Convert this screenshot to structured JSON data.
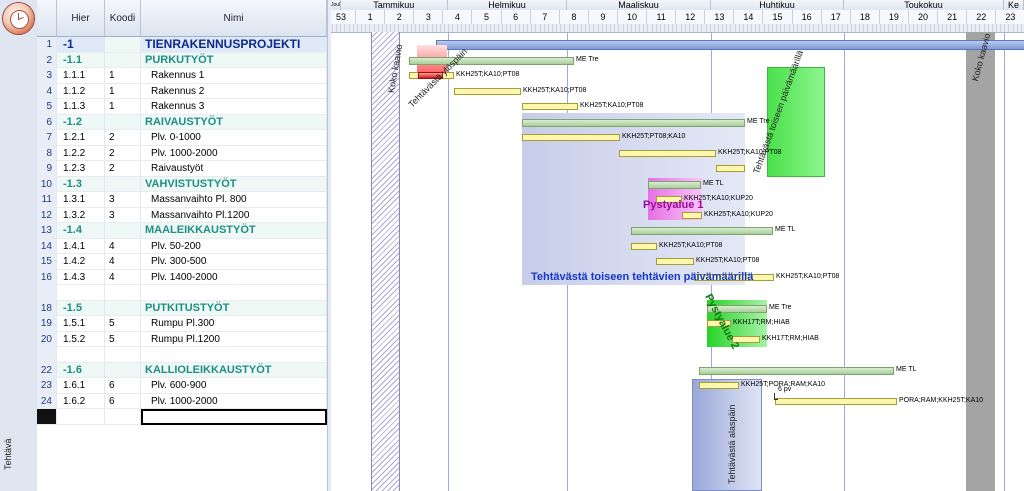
{
  "side": {
    "tab_label": "Tehtävä"
  },
  "grid": {
    "headers": {
      "hier": "Hier",
      "koodi": "Koodi",
      "nimi": "Nimi"
    },
    "rows": [
      {
        "n": "1",
        "hier": "-1",
        "koodi": "",
        "nimi": "TIENRAKENNUSPROJEKTI",
        "type": "level0"
      },
      {
        "n": "2",
        "hier": "-1.1",
        "koodi": "",
        "nimi": "PURKUTYÖT",
        "type": "summary"
      },
      {
        "n": "3",
        "hier": "1.1.1",
        "koodi": "1",
        "nimi": "Rakennus 1",
        "type": "task"
      },
      {
        "n": "4",
        "hier": "1.1.2",
        "koodi": "1",
        "nimi": "Rakennus 2",
        "type": "task"
      },
      {
        "n": "5",
        "hier": "1.1.3",
        "koodi": "1",
        "nimi": "Rakennus 3",
        "type": "task"
      },
      {
        "n": "6",
        "hier": "-1.2",
        "koodi": "",
        "nimi": "RAIVAUSTYÖT",
        "type": "summary"
      },
      {
        "n": "7",
        "hier": "1.2.1",
        "koodi": "2",
        "nimi": "Plv. 0-1000",
        "type": "task"
      },
      {
        "n": "8",
        "hier": "1.2.2",
        "koodi": "2",
        "nimi": "Plv. 1000-2000",
        "type": "task"
      },
      {
        "n": "9",
        "hier": "1.2.3",
        "koodi": "2",
        "nimi": "Raivaustyöt",
        "type": "task"
      },
      {
        "n": "10",
        "hier": "-1.3",
        "koodi": "",
        "nimi": "VAHVISTUSTYÖT",
        "type": "summary"
      },
      {
        "n": "11",
        "hier": "1.3.1",
        "koodi": "3",
        "nimi": "Massanvaihto Pl. 800",
        "type": "task"
      },
      {
        "n": "12",
        "hier": "1.3.2",
        "koodi": "3",
        "nimi": "Massanvaihto Pl.1200",
        "type": "task"
      },
      {
        "n": "13",
        "hier": "-1.4",
        "koodi": "",
        "nimi": "MAALEIKKAUSTYÖT",
        "type": "summary"
      },
      {
        "n": "14",
        "hier": "1.4.1",
        "koodi": "4",
        "nimi": "Plv. 50-200",
        "type": "task"
      },
      {
        "n": "15",
        "hier": "1.4.2",
        "koodi": "4",
        "nimi": "Plv. 300-500",
        "type": "task"
      },
      {
        "n": "16",
        "hier": "1.4.3",
        "koodi": "4",
        "nimi": "Plv. 1400-2000",
        "type": "task"
      },
      {
        "n": "",
        "hier": "",
        "koodi": "",
        "nimi": "",
        "type": "blank"
      },
      {
        "n": "18",
        "hier": "-1.5",
        "koodi": "",
        "nimi": "PUTKITUSTYÖT",
        "type": "summary"
      },
      {
        "n": "19",
        "hier": "1.5.1",
        "koodi": "5",
        "nimi": "Rumpu Pl.300",
        "type": "task"
      },
      {
        "n": "20",
        "hier": "1.5.2",
        "koodi": "5",
        "nimi": "Rumpu Pl.1200",
        "type": "task"
      },
      {
        "n": "",
        "hier": "",
        "koodi": "",
        "nimi": "",
        "type": "blank"
      },
      {
        "n": "22",
        "hier": "-1.6",
        "koodi": "",
        "nimi": "KALLIOLEIKKAUSTYÖT",
        "type": "summary"
      },
      {
        "n": "23",
        "hier": "1.6.1",
        "koodi": "6",
        "nimi": "Plv. 600-900",
        "type": "task"
      },
      {
        "n": "24",
        "hier": "1.6.2",
        "koodi": "6",
        "nimi": "Plv. 1000-2000",
        "type": "task"
      },
      {
        "n": "",
        "hier": "",
        "koodi": "",
        "nimi": "",
        "type": "sel"
      }
    ]
  },
  "timeline": {
    "months": [
      "Joul",
      "Tammikuu",
      "Helmikuu",
      "Maaliskuu",
      "Huhtikuu",
      "Toukokuu",
      "Ke"
    ],
    "weeks": [
      "53",
      "1",
      "2",
      "3",
      "4",
      "5",
      "6",
      "7",
      "8",
      "9",
      "10",
      "11",
      "12",
      "13",
      "14",
      "15",
      "16",
      "17",
      "18",
      "19",
      "20",
      "21",
      "22",
      "23"
    ]
  },
  "gantt": {
    "labels": {
      "r2": "ME Tre",
      "r3": "KKH25T;KA10;PT08",
      "r4": "KKH25T;KA10;PT08",
      "r5": "KKH25T;KA10;PT08",
      "r6": "ME Tre",
      "r7": "KKH25T;PT08;KA10",
      "r8": "KKH25T;KA10;PT08",
      "r10": "ME TL",
      "r11": "KKH25T;KA10;KUP20",
      "r12": "KKH25T;KA10;KUP20",
      "r13": "ME TL",
      "r14": "KKH25T;KA10;PT08",
      "r15": "KKH25T;KA10;PT08",
      "r16": "KKH25T;KA10;PT08",
      "r18": "ME Tre",
      "r19": "KKH17T;RM;HIAB",
      "r20": "KKH17T;RM;HIAB",
      "r22": "ME TL",
      "r23": "KKH25T;PORA;RAM;KA10",
      "r24": "PORA;RAM;KKH25T;KA10",
      "lag": "6 pv"
    },
    "annotations": {
      "koko_kaavio_1": "Koko kaavio",
      "koko_kaavio_2": "Koko kaavio",
      "ylospain": "Tehtävästä ylöspäin",
      "range_text": "Tehtävästä toiseen tehtävien päivämäärillä",
      "range_text_green": "Tehtävästä toiseen päivämäärillä",
      "pystyalue1": "Pystyalue 1",
      "pystyalue2": "Pystyalue 2",
      "alaspain": "Tehtävästä alaspäin"
    }
  }
}
